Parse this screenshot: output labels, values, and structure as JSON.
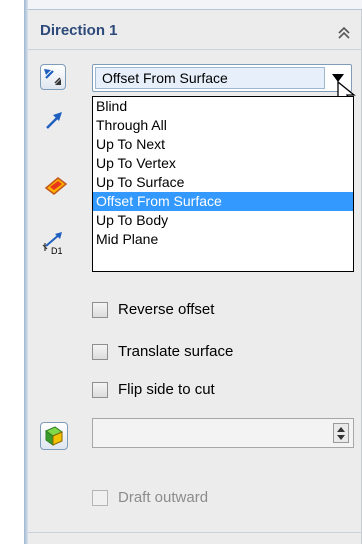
{
  "group": {
    "title": "Direction 1"
  },
  "end_condition": {
    "selected": "Offset From Surface",
    "options": [
      "Blind",
      "Through All",
      "Up To Next",
      "Up To Vertex",
      "Up To Surface",
      "Offset From Surface",
      "Up To Body",
      "Mid Plane"
    ],
    "selected_index": 5
  },
  "depth_icon_label": "D1",
  "checkboxes": [
    {
      "label": "Reverse offset",
      "checked": false,
      "enabled": true
    },
    {
      "label": "Translate surface",
      "checked": false,
      "enabled": true
    },
    {
      "label": "Flip side to cut",
      "checked": false,
      "enabled": true
    },
    {
      "label": "Draft outward",
      "checked": false,
      "enabled": false
    }
  ],
  "offset_value": ""
}
